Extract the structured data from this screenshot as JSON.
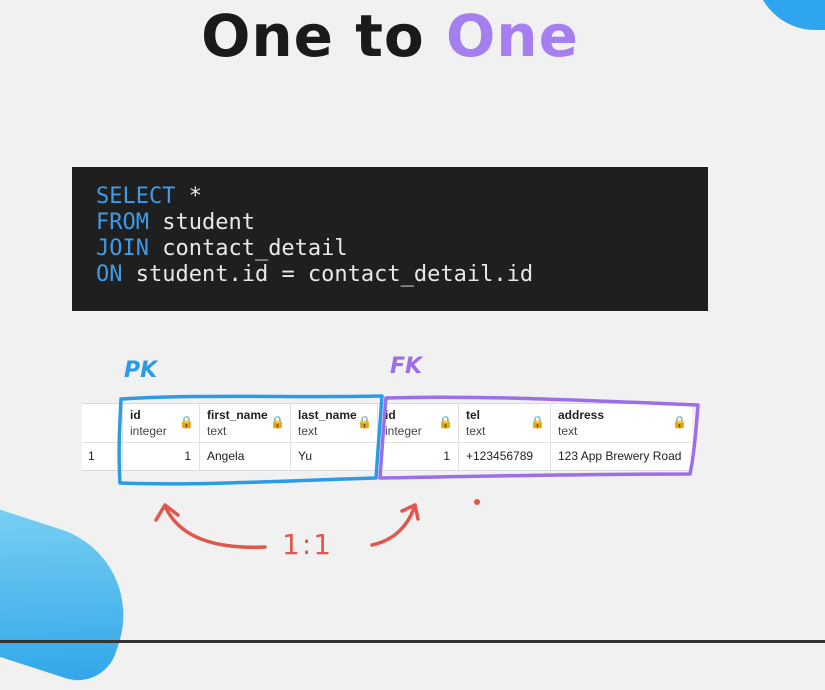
{
  "slide": {
    "title_main": "One to",
    "title_accent": "One",
    "title_color": "#1a1a1a",
    "accent_color": "#a57ff0"
  },
  "code": {
    "lines": [
      {
        "keyword": "SELECT",
        "rest": " *"
      },
      {
        "keyword": "FROM",
        "rest": " student"
      },
      {
        "keyword": "JOIN",
        "rest": " contact_detail"
      },
      {
        "keyword": "ON",
        "rest": " student.id = contact_detail.id"
      }
    ],
    "keyword_color": "#3e9be7"
  },
  "table": {
    "columns": [
      {
        "name": "id",
        "type": "integer"
      },
      {
        "name": "first_name",
        "type": "text"
      },
      {
        "name": "last_name",
        "type": "text"
      },
      {
        "name": "id",
        "type": "integer"
      },
      {
        "name": "tel",
        "type": "text"
      },
      {
        "name": "address",
        "type": "text"
      }
    ],
    "rows": [
      {
        "row_number": "1",
        "cells": [
          "1",
          "Angela",
          "Yu",
          "1",
          "+123456789",
          "123 App Brewery Road"
        ]
      }
    ],
    "lock_icon": "lock-icon"
  },
  "annotations": {
    "pk_label": "PK",
    "fk_label": "FK",
    "ratio_label": "1:1",
    "pk_color": "#2c9be6",
    "fk_color": "#9c6ee8",
    "arrow_color": "#e0584c"
  }
}
